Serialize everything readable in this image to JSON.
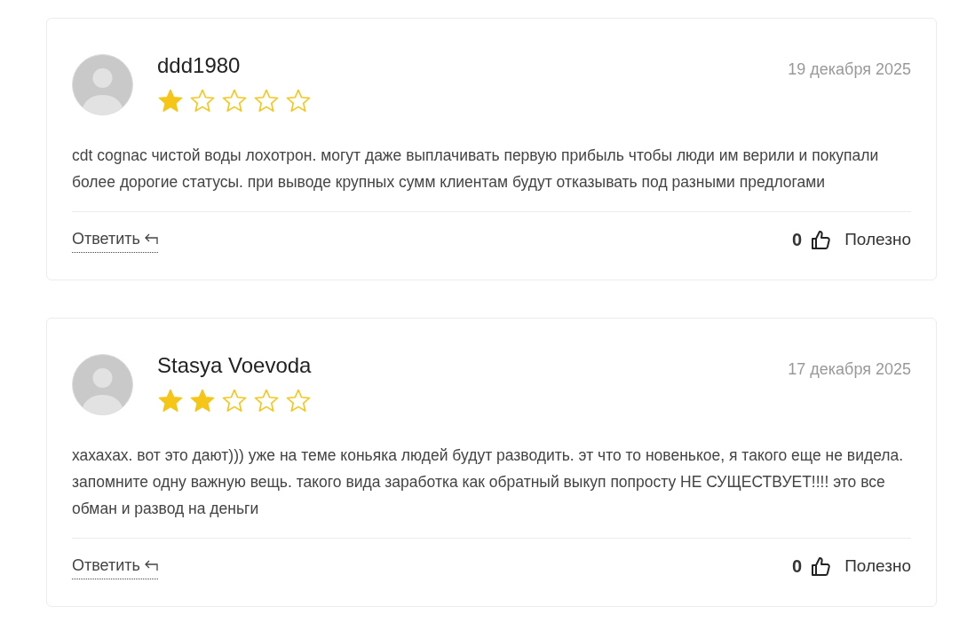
{
  "reviews": [
    {
      "author": "ddd1980",
      "date": "19 декабря 2025",
      "stars": 1,
      "text": "cdt cognac чистой воды лохотрон. могут даже выплачивать первую прибыль чтобы люди им верили и покупали более дорогие статусы. при выводе крупных сумм клиентам будут отказывать под разными предлогами",
      "reply": "Ответить",
      "likes": "0",
      "useful": "Полезно"
    },
    {
      "author": "Stasya Voevoda",
      "date": "17 декабря 2025",
      "stars": 2,
      "text": "хахахах. вот это дают))) уже на теме коньяка людей будут разводить. эт что то новенькое, я такого еще не видела. запомните одну важную вещь. такого вида заработка как обратный выкуп попросту НЕ СУЩЕСТВУЕТ!!!! это все обман и развод на деньги",
      "reply": "Ответить",
      "likes": "0",
      "useful": "Полезно"
    }
  ]
}
